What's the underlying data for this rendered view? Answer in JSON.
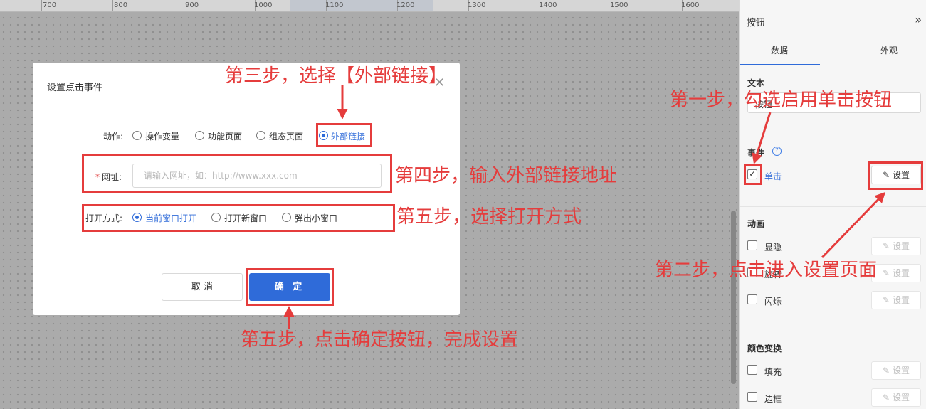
{
  "ruler": {
    "labels": [
      "700",
      "800",
      "900",
      "1000",
      "1100",
      "1200",
      "1300",
      "1400",
      "1500",
      "1600"
    ]
  },
  "panel": {
    "title": "按钮",
    "collapse_icon": "double-chevron-right-icon",
    "tabs": [
      "数据",
      "外观"
    ],
    "text_section": {
      "title": "文本",
      "value": "按钮"
    },
    "event_section": {
      "title": "事件",
      "help_icon": "question-circle-icon",
      "click_label": "单击",
      "click_checked": true,
      "set_label": "设置"
    },
    "animation_section": {
      "title": "动画",
      "items": [
        "显隐",
        "旋转",
        "闪烁"
      ],
      "set_label": "设置"
    },
    "color_section": {
      "title": "颜色变换",
      "items": [
        "填充",
        "边框"
      ],
      "set_label": "设置"
    }
  },
  "dialog": {
    "title": "设置点击事件",
    "close_icon": "close-icon",
    "action_label": "动作:",
    "action_options": [
      "操作变量",
      "功能页面",
      "组态页面",
      "外部链接"
    ],
    "action_selected": "外部链接",
    "url_label": "网址:",
    "url_placeholder": "请输入网址，如：http://www.xxx.com",
    "url_value": "",
    "open_label": "打开方式:",
    "open_options": [
      "当前窗口打开",
      "打开新窗口",
      "弹出小窗口"
    ],
    "open_selected": "当前窗口打开",
    "cancel_label": "取 消",
    "ok_label": "确 定"
  },
  "annotations": {
    "step1": "第一步，勾选启用单击按钮",
    "step2": "第二步，点击进入设置页面",
    "step3": "第三步，选择【外部链接】",
    "step4": "第四步，输入外部链接地址",
    "step5a": "第五步，选择打开方式",
    "step5b": "第五步，点击确定按钮，完成设置",
    "color": "#e53c3c"
  },
  "colors": {
    "accent": "#2f6bd9"
  }
}
